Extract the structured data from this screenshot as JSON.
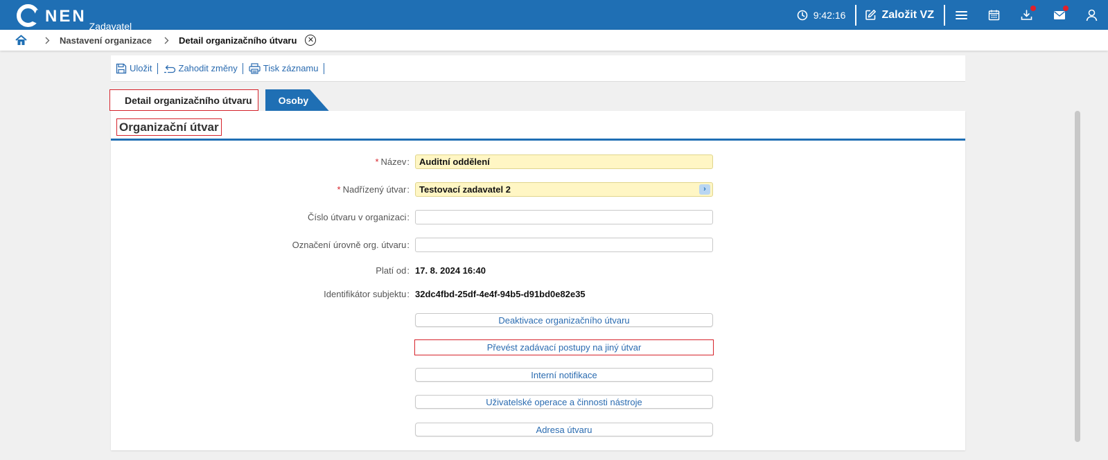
{
  "app": {
    "logo": "NEN",
    "subtitle": "Zadavatel"
  },
  "header": {
    "time": "9:42:16",
    "create_label": "Založit VZ",
    "icons": [
      "menu-icon",
      "calendar-icon",
      "download-icon",
      "mail-icon",
      "user-icon"
    ]
  },
  "breadcrumb": {
    "items": [
      "Nastavení organizace",
      "Detail organizačního útvaru"
    ]
  },
  "toolbar": {
    "save": "Uložit",
    "discard": "Zahodit změny",
    "print": "Tisk záznamu"
  },
  "tabs": [
    {
      "label": "Detail organizačního útvaru",
      "active": true
    },
    {
      "label": "Osoby",
      "active": false
    }
  ],
  "section": {
    "title": "Organizační útvar"
  },
  "form": {
    "nazev": {
      "label": "Název",
      "value": "Auditní oddělení"
    },
    "nadrizeny": {
      "label": "Nadřízený útvar",
      "value": "Testovací zadavatel 2"
    },
    "cislo": {
      "label": "Číslo útvaru v organizaci",
      "value": ""
    },
    "oznaceni": {
      "label": "Označení úrovně org. útvaru",
      "value": ""
    },
    "plati_od": {
      "label": "Platí od",
      "value": "17. 8. 2024 16:40"
    },
    "identifikator": {
      "label": "Identifikátor subjektu",
      "value": "32dc4fbd-25df-4e4f-94b5-d91bd0e82e35"
    }
  },
  "actions": [
    "Deaktivace organizačního útvaru",
    "Převést zadávací postupy na jiný útvar",
    "Interní notifikace",
    "Uživatelské operace a činnosti nástroje",
    "Adresa útvaru"
  ],
  "colors": {
    "brand": "#1f6fb4",
    "highlight": "#d6222a",
    "required_bg": "#fff6c4"
  }
}
